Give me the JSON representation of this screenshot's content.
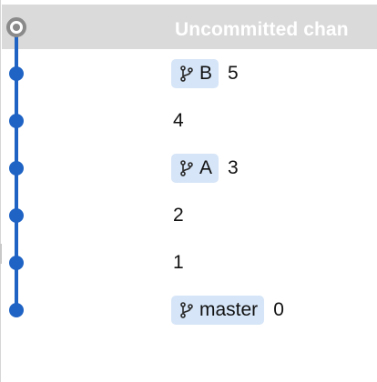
{
  "header": {
    "title": "Uncommitted chan"
  },
  "commits": [
    {
      "branch": "B",
      "label": "5"
    },
    {
      "branch": null,
      "label": "4"
    },
    {
      "branch": "A",
      "label": "3"
    },
    {
      "branch": null,
      "label": "2"
    },
    {
      "branch": null,
      "label": "1"
    },
    {
      "branch": "master",
      "label": "0"
    }
  ],
  "colors": {
    "graph": "#1f63c4",
    "branch_tag_bg": "#d6e5f7",
    "header_bg": "#dadada",
    "uncommitted_node": "#8a8a8a"
  },
  "icons": {
    "branch": "git-branch-icon",
    "uncommitted": "uncommitted-node-icon"
  }
}
